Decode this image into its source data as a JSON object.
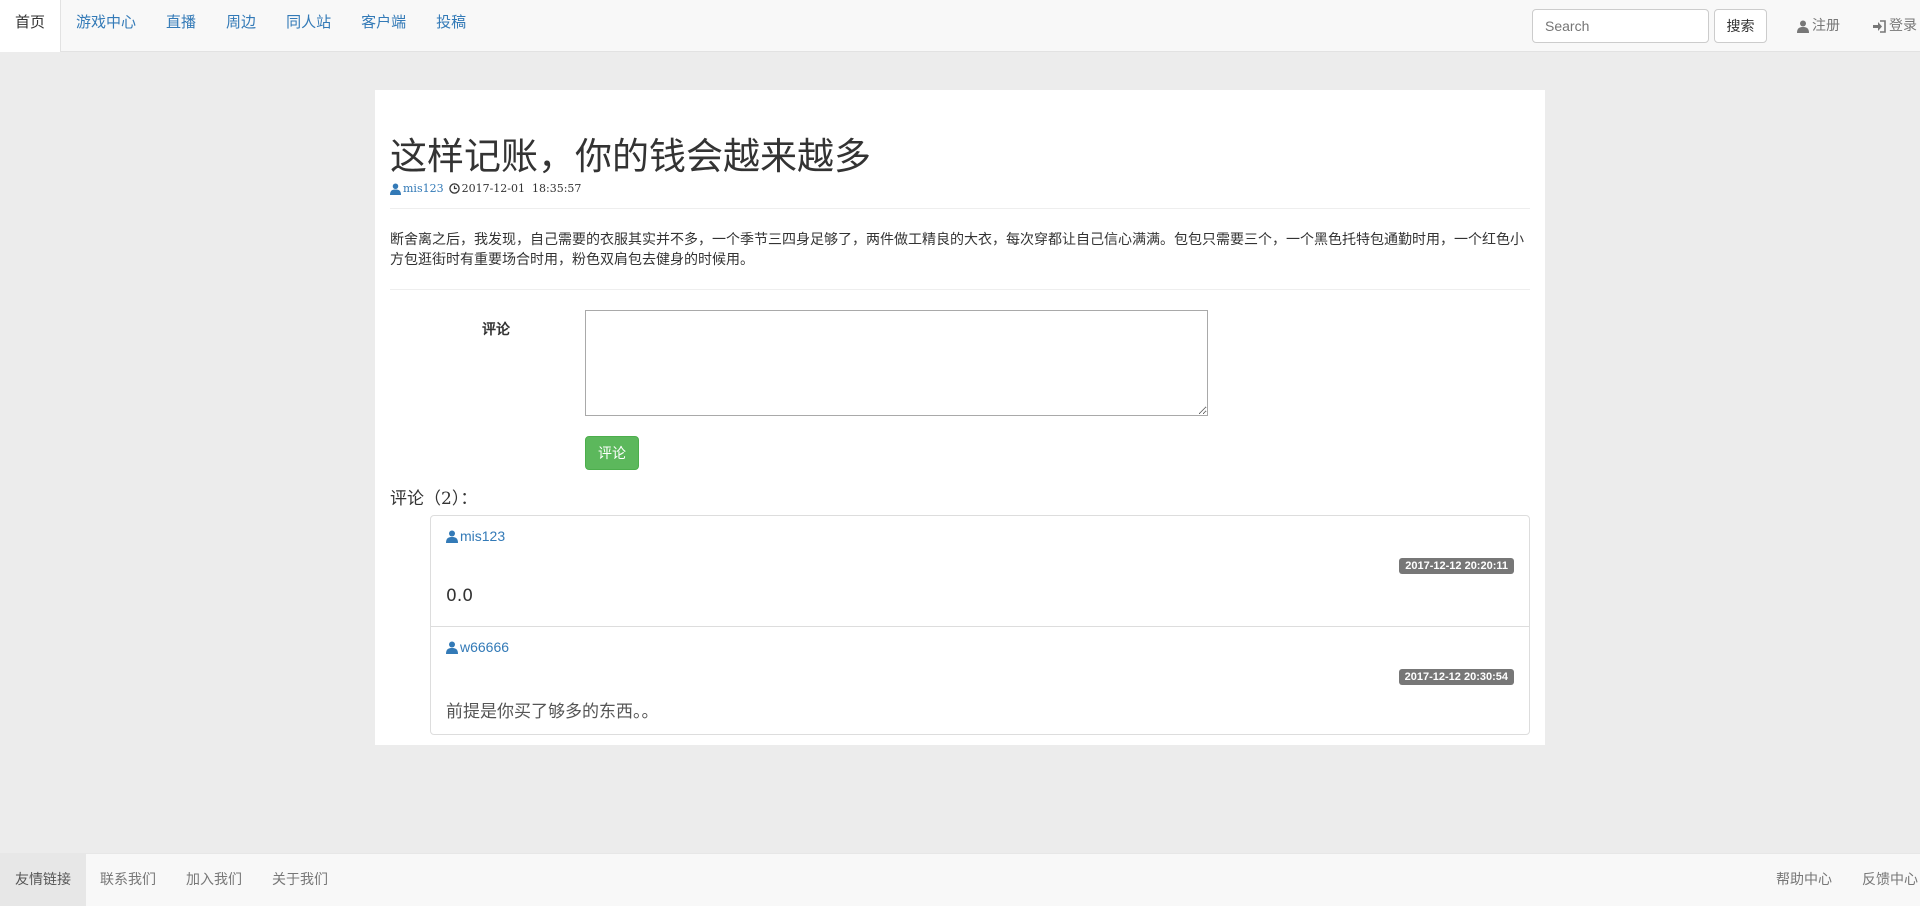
{
  "nav": {
    "items": [
      {
        "label": "首页",
        "active": true
      },
      {
        "label": "游戏中心"
      },
      {
        "label": "直播"
      },
      {
        "label": "周边"
      },
      {
        "label": "同人站"
      },
      {
        "label": "客户端"
      },
      {
        "label": "投稿"
      }
    ],
    "search_placeholder": "Search",
    "search_button": "搜索",
    "register": "注册",
    "login": "登录"
  },
  "article": {
    "title": "这样记账，你的钱会越来越多",
    "author": "mis123",
    "datetime": "2017-12-01  18:35:57",
    "content": "断舍离之后，我发现，自己需要的衣服其实并不多，一个季节三四身足够了，两件做工精良的大衣，每次穿都让自己信心满满。包包只需要三个，一个黑色托特包通勤时用，一个红色小方包逛街时有重要场合时用，粉色双肩包去健身的时候用。"
  },
  "comment_form": {
    "label": "评论",
    "textarea_value": "",
    "submit": "评论"
  },
  "comments": {
    "heading": "评论（2）：",
    "items": [
      {
        "user": "mis123",
        "time": "2017-12-12 20:20:11",
        "text": "0.0"
      },
      {
        "user": "w66666",
        "time": "2017-12-12 20:30:54",
        "text": "前提是你买了够多的东西。。"
      }
    ]
  },
  "footer": {
    "left": [
      {
        "label": "友情链接",
        "active": true
      },
      {
        "label": "联系我们"
      },
      {
        "label": "加入我们"
      },
      {
        "label": "关于我们"
      }
    ],
    "right": [
      {
        "label": "帮助中心"
      },
      {
        "label": "反馈中心"
      }
    ]
  },
  "colors": {
    "link": "#337ab7",
    "success": "#5cb85c",
    "badge": "#777777",
    "background": "#ececec"
  }
}
